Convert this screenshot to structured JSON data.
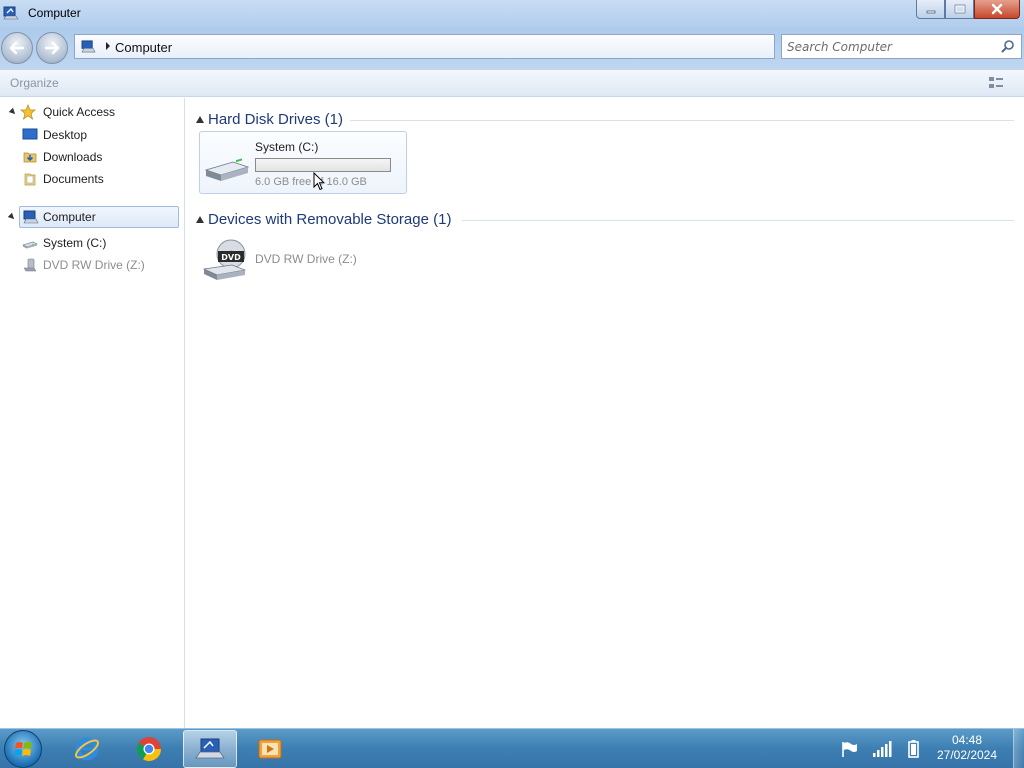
{
  "window": {
    "title": "Computer",
    "title_icon": "computer-icon",
    "caption_buttons": [
      "minimize",
      "maximize",
      "close"
    ]
  },
  "navigation": {
    "back_icon": "back-arrow-icon",
    "forward_icon": "forward-arrow-icon",
    "address_icon": "computer-icon",
    "breadcrumb": "Computer",
    "search_placeholder": "Search Computer",
    "search_icon": "search-icon"
  },
  "commandbar": {
    "organize_label": "Organize",
    "view_icon": "change-view-icon"
  },
  "sidebar": {
    "quick_access": {
      "label": "Quick Access",
      "icon": "star-icon",
      "items": [
        {
          "label": "Desktop",
          "icon": "desktop-icon"
        },
        {
          "label": "Downloads",
          "icon": "downloads-folder-icon"
        },
        {
          "label": "Documents",
          "icon": "documents-folder-icon"
        }
      ]
    },
    "computer": {
      "label": "Computer",
      "icon": "computer-icon",
      "items": [
        {
          "label": "System (C:)",
          "icon": "hard-drive-icon"
        },
        {
          "label": "DVD RW Drive (Z:)",
          "icon": "dvd-drive-icon"
        }
      ]
    }
  },
  "main": {
    "groups": [
      {
        "label": "Hard Disk Drives (1)",
        "drives": [
          {
            "name": "System (C:)",
            "free_text": "6.0 GB free of 16.0 GB",
            "used_fraction": 0.0
          }
        ]
      },
      {
        "label": "Devices with Removable Storage (1)",
        "devices": [
          {
            "name": "DVD RW Drive (Z:)",
            "icon_badge": "DVD"
          }
        ]
      }
    ]
  },
  "taskbar": {
    "start_icon": "windows-start-icon",
    "apps": [
      {
        "name": "internet-explorer",
        "icon": "internet-explorer-icon"
      },
      {
        "name": "chrome",
        "icon": "chrome-icon"
      },
      {
        "name": "computer-explorer",
        "icon": "computer-icon",
        "active": true
      },
      {
        "name": "media-player",
        "icon": "media-player-icon"
      }
    ],
    "tray": [
      "action-center-flag-icon",
      "network-signal-icon",
      "battery-icon"
    ],
    "time": "04:48",
    "date": "27/02/2024"
  }
}
